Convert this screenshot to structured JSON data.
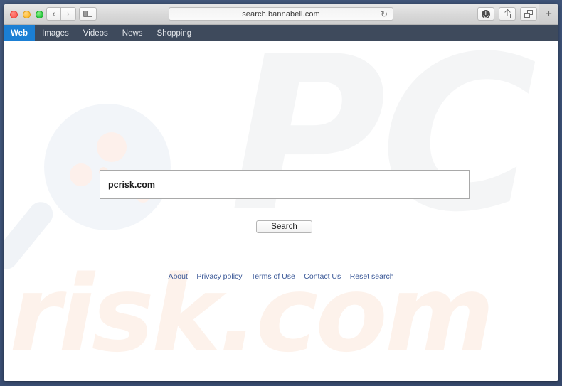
{
  "browser": {
    "traffic_lights": [
      "close",
      "minimize",
      "zoom"
    ],
    "back_label": "‹",
    "forward_label": "›",
    "sidebar_label": "sidebar",
    "url": "search.bannabell.com",
    "reload_label": "↻",
    "download_label": "downloads",
    "share_label": "share",
    "tabs_label": "show-tabs",
    "newtab_label": "+"
  },
  "sitenav": {
    "items": [
      {
        "label": "Web",
        "active": true
      },
      {
        "label": "Images",
        "active": false
      },
      {
        "label": "Videos",
        "active": false
      },
      {
        "label": "News",
        "active": false
      },
      {
        "label": "Shopping",
        "active": false
      }
    ]
  },
  "search": {
    "query": "pcrisk.com",
    "placeholder": "",
    "button_label": "Search"
  },
  "footer": {
    "links": [
      "About",
      "Privacy policy",
      "Terms of Use",
      "Contact Us",
      "Reset search"
    ]
  },
  "watermark": {
    "top_text": "PC",
    "bottom_text": "risk.com"
  },
  "colors": {
    "nav_bar": "#3e4a5c",
    "active_tab": "#1b7fd4",
    "link": "#3b5998",
    "desktop": "#3f5579",
    "watermark_gray": "#f4f5f6",
    "watermark_peach": "#fdf2eb",
    "watermark_blue": "#f2f5f9"
  }
}
